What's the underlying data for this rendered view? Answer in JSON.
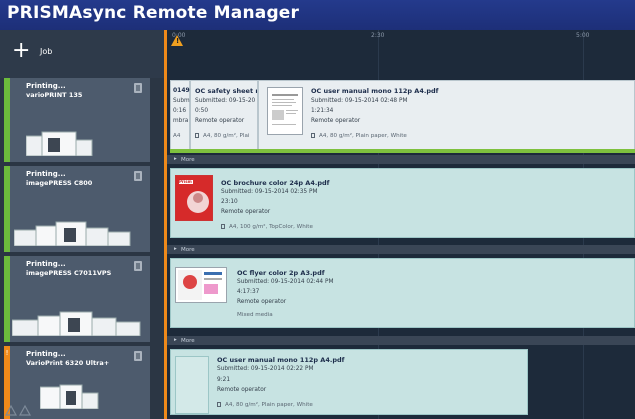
{
  "app": {
    "title": "PRISMAsync Remote Manager"
  },
  "toolbar": {
    "add_job_label": "Job",
    "plus_glyph": "+"
  },
  "timeline": {
    "ticks": [
      "0:00",
      "2:30",
      "5:00"
    ],
    "warning_glyph": "!"
  },
  "printers": [
    {
      "status": "Printing...",
      "name": "varioPRINT 135",
      "status_color": "#6cbb3c"
    },
    {
      "status": "Printing...",
      "name": "imagePRESS C800",
      "status_color": "#6cbb3c"
    },
    {
      "status": "Printing...",
      "name": "imagePRESS C7011VPS",
      "status_color": "#6cbb3c"
    },
    {
      "status": "Printing...",
      "name": "VarioPrint 6320 Ultra+",
      "status_color": "#f08a1a",
      "warning_glyph": "!"
    }
  ],
  "more_label": "More",
  "jobs": {
    "p1_partial": {
      "l1": "0149",
      "l2": "Subm",
      "l3": "0:16",
      "l4": "mbra",
      "l5": "A4"
    },
    "p1_safety": {
      "title": "OC safety sheet m",
      "submitted": "Submitted: 09-15-20",
      "duration": "0:50",
      "operator": "Remote operator",
      "media": "A4, 80 g/m², Plai"
    },
    "p1_main": {
      "title": "OC user manual mono 112p A4.pdf",
      "submitted": "Submitted: 09-15-2014 02:48 PM",
      "duration": "1:21:34",
      "operator": "Remote operator",
      "media": "A4, 80 g/m², Plain paper, White"
    },
    "p2_main": {
      "title": "OC brochure color 24p A4.pdf",
      "submitted": "Submitted: 09-15-2014 02:35 PM",
      "duration": "23:10",
      "operator": "Remote operator",
      "media": "A4, 100 g/m², TopColor, White"
    },
    "p3_main": {
      "title": "OC flyer color 2p A3.pdf",
      "submitted": "Submitted: 09-15-2014 02:44 PM",
      "duration": "4:17:37",
      "operator": "Remote operator",
      "media": "Mixed media"
    },
    "p4_main": {
      "title": "OC user manual mono 112p A4.pdf",
      "submitted": "Submitted: 09-15-2014 02:22 PM",
      "duration": "9:21",
      "operator": "Remote operator",
      "media": "A4, 80 g/m², Plain paper, White"
    }
  },
  "thumbnails": {
    "brochure_brand": "Prism"
  },
  "colors": {
    "accent_orange": "#f08a1a",
    "status_green": "#6cbb3c",
    "card_teal": "#c7e3e2"
  }
}
